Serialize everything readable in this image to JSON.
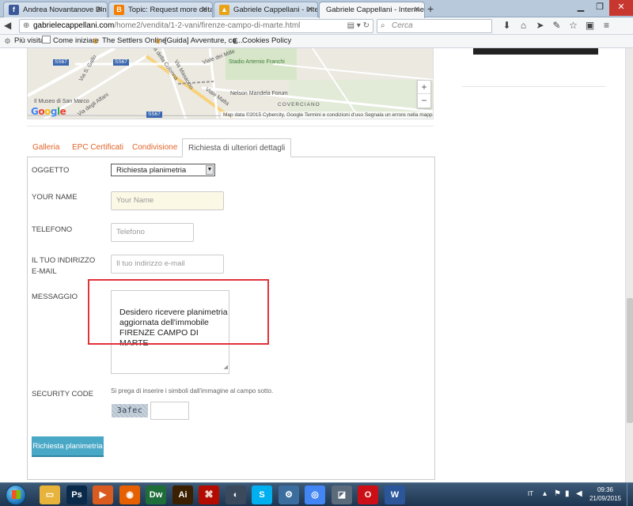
{
  "browser": {
    "tabs": [
      {
        "label": "Andrea Novantanove Bini",
        "icon": "facebook-icon",
        "color": "#3b5998",
        "glyph": "f"
      },
      {
        "label": "Topic: Request more detail...",
        "icon": "blogger-icon",
        "color": "#f57d00",
        "glyph": "B"
      },
      {
        "label": "Gabriele Cappellani - Inter...",
        "icon": "drive-icon",
        "color": "#e8a317",
        "glyph": "▲"
      },
      {
        "label": "Gabriele Cappellani - Intermedi...",
        "icon": "drive-icon",
        "color": "#e8a317",
        "glyph": "▲"
      }
    ],
    "new_tab": "+",
    "url_domain": "gabrielecappellani.com",
    "url_path": "/home2/vendita/1-2-vani/firenze-campo-di-marte.html",
    "search_placeholder": "Cerca",
    "bookmarks": [
      {
        "label": "Più visitati",
        "icon": "gear-icon"
      },
      {
        "label": "Come iniziare",
        "icon": "page-icon"
      },
      {
        "label": "The Settlers Online",
        "icon": "crown-icon"
      },
      {
        "label": "[Guida] Avventure, co...",
        "icon": "crown-icon"
      },
      {
        "label": "Cookies Policy",
        "icon": "e-icon"
      }
    ]
  },
  "map": {
    "labels": [
      "Via S. Gallo",
      "Il Museo di San Marco",
      "Stadio Artemio Franchi",
      "Nelson Mandela Forum",
      "COVERCIANO",
      "Viale Malta",
      "Via Masaccio",
      "Viale dei Mille",
      "Via degli Alfani",
      "Via della Colonna"
    ],
    "shields": [
      "SS67",
      "SS67",
      "SS67"
    ],
    "zoom_in": "+",
    "zoom_out": "−",
    "logo": "Google",
    "attribution": "Map data ©2015 Cybercity, Google    Termini e condizioni d'uso    Segnala un errore nella mappa"
  },
  "detail_tabs": [
    "Galleria",
    "EPC Certificati",
    "Condivisione",
    "Richiesta di ulteriori dettagli"
  ],
  "form": {
    "oggetto_label": "OGGETTO",
    "oggetto_value": "Richiesta planimetria",
    "name_label": "YOUR NAME",
    "name_placeholder": "Your Name",
    "phone_label": "TELEFONO",
    "phone_placeholder": "Telefono",
    "email_label_line1": "IL TUO INDIRIZZO",
    "email_label_line2": "E-MAIL",
    "email_placeholder": "Il tuo indirizzo e-mail",
    "message_label": "MESSAGGIO",
    "message_value": "Desidero ricevere planimetria\naggiornata dell'immobile\nFIRENZE CAMPO DI MARTE",
    "security_label": "SECURITY CODE",
    "security_help": "Si prega di inserire i simboli dall'immagine al campo sotto.",
    "captcha": "3afec",
    "submit_label": "Richiesta planimetria"
  },
  "taskbar": {
    "apps": [
      {
        "name": "explorer-icon",
        "color": "#e8b33a",
        "glyph": "▭"
      },
      {
        "name": "photoshop-icon",
        "color": "#0a2a4a",
        "glyph": "Ps"
      },
      {
        "name": "media-player-icon",
        "color": "#d95b1f",
        "glyph": "▶"
      },
      {
        "name": "firefox-icon",
        "color": "#e66000",
        "glyph": "◉"
      },
      {
        "name": "dreamweaver-icon",
        "color": "#1f6e3a",
        "glyph": "Dw"
      },
      {
        "name": "illustrator-icon",
        "color": "#3a1f00",
        "glyph": "Ai"
      },
      {
        "name": "acrobat-icon",
        "color": "#b30b00",
        "glyph": "⌘"
      },
      {
        "name": "shell-icon",
        "color": "#3a4a5c",
        "glyph": "◐"
      },
      {
        "name": "skype-icon",
        "color": "#00aff0",
        "glyph": "S"
      },
      {
        "name": "network-icon",
        "color": "#3b6e9e",
        "glyph": "⚙"
      },
      {
        "name": "chrome-icon",
        "color": "#4285f4",
        "glyph": "◎"
      },
      {
        "name": "reader-icon",
        "color": "#5b6b7b",
        "glyph": "◪"
      },
      {
        "name": "opera-icon",
        "color": "#cc0f16",
        "glyph": "O"
      },
      {
        "name": "word-icon",
        "color": "#2b579a",
        "glyph": "W"
      }
    ],
    "language": "IT",
    "time": "09:36",
    "date": "21/09/2015"
  }
}
